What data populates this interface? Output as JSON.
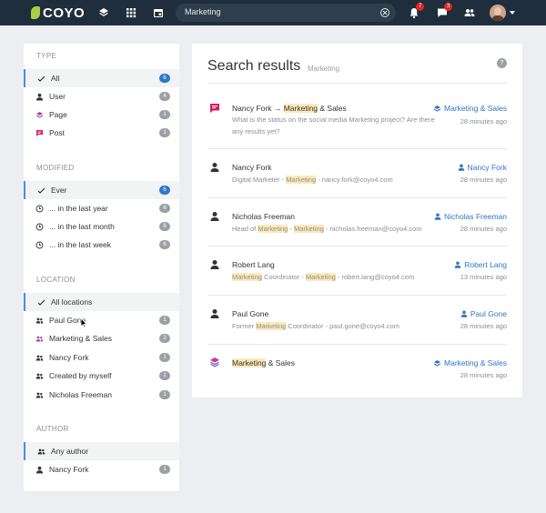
{
  "topbar": {
    "logo": "COYO",
    "search_value": "Marketing",
    "notifications_count": "7",
    "messages_count": "3"
  },
  "filters": {
    "type": {
      "title": "TYPE",
      "items": [
        {
          "label": "All",
          "count": "6",
          "icon": "check-icon"
        },
        {
          "label": "User",
          "count": "4",
          "icon": "user-icon"
        },
        {
          "label": "Page",
          "count": "1",
          "icon": "layers-icon"
        },
        {
          "label": "Post",
          "count": "1",
          "icon": "chat-icon"
        }
      ]
    },
    "modified": {
      "title": "MODIFIED",
      "items": [
        {
          "label": "Ever",
          "count": "6",
          "icon": "check-icon"
        },
        {
          "label": "... in the last year",
          "count": "6",
          "icon": "clock-icon"
        },
        {
          "label": "... in the last month",
          "count": "6",
          "icon": "clock-icon"
        },
        {
          "label": "... in the last week",
          "count": "6",
          "icon": "clock-icon"
        }
      ]
    },
    "location": {
      "title": "LOCATION",
      "items": [
        {
          "label": "All locations",
          "icon": "check-icon"
        },
        {
          "label": "Paul Gone",
          "count": "1",
          "icon": "users-icon"
        },
        {
          "label": "Marketing & Sales",
          "count": "2",
          "icon": "users-icon"
        },
        {
          "label": "Nancy Fork",
          "count": "1",
          "icon": "users-icon"
        },
        {
          "label": "Created by myself",
          "count": "1",
          "icon": "users-icon"
        },
        {
          "label": "Nicholas Freeman",
          "count": "1",
          "icon": "users-icon"
        }
      ]
    },
    "author": {
      "title": "AUTHOR",
      "items": [
        {
          "label": "Any author",
          "icon": "users-icon"
        },
        {
          "label": "Nancy Fork",
          "count": "1",
          "icon": "user-icon"
        }
      ]
    }
  },
  "results": {
    "title": "Search results",
    "query": "Marketing",
    "help": "?",
    "rows": [
      {
        "title_pre": "Nancy Fork → ",
        "title_hl": "Marketing",
        "title_post": " & Sales",
        "subtitle": "What is the status on the social media Marketing project? Are there any results yet?",
        "source": "Marketing & Sales",
        "time": "28 minutes ago"
      },
      {
        "title": "Nancy Fork",
        "sub_a": "Digital Marketer - ",
        "sub_hl1": "Marketing",
        "sub_b": " - nancy.fork@coyo4.com",
        "source": "Nancy Fork",
        "time": "28 minutes ago"
      },
      {
        "title": "Nicholas Freeman",
        "sub_a": "Head of ",
        "sub_hl1": "Marketing",
        "sub_b": " - ",
        "sub_hl2": "Marketing",
        "sub_c": " - nicholas.freeman@coyo4.com",
        "source": "Nicholas Freeman",
        "time": "28 minutes ago"
      },
      {
        "title": "Robert Lang",
        "sub_hl1": "Marketing",
        "sub_b": " Coordinator - ",
        "sub_hl2": "Marketing",
        "sub_c": " - robert.lang@coyo4.com",
        "source": "Robert Lang",
        "time": "13 minutes ago"
      },
      {
        "title": "Paul Gone",
        "sub_a": "Former ",
        "sub_hl1": "Marketing",
        "sub_b": " Coordinator - paul.gone@coyo4.com",
        "source": "Paul Gone",
        "time": "28 minutes ago"
      },
      {
        "title_hl": "Marketing",
        "title_post": " & Sales",
        "source": "Marketing & Sales",
        "time": "28 minutes ago"
      }
    ]
  },
  "colors": {
    "topbar": "#1f2d3d",
    "accent": "#2f76c6",
    "highlight": "#fce9b8",
    "post_icon": "#d81b60"
  }
}
